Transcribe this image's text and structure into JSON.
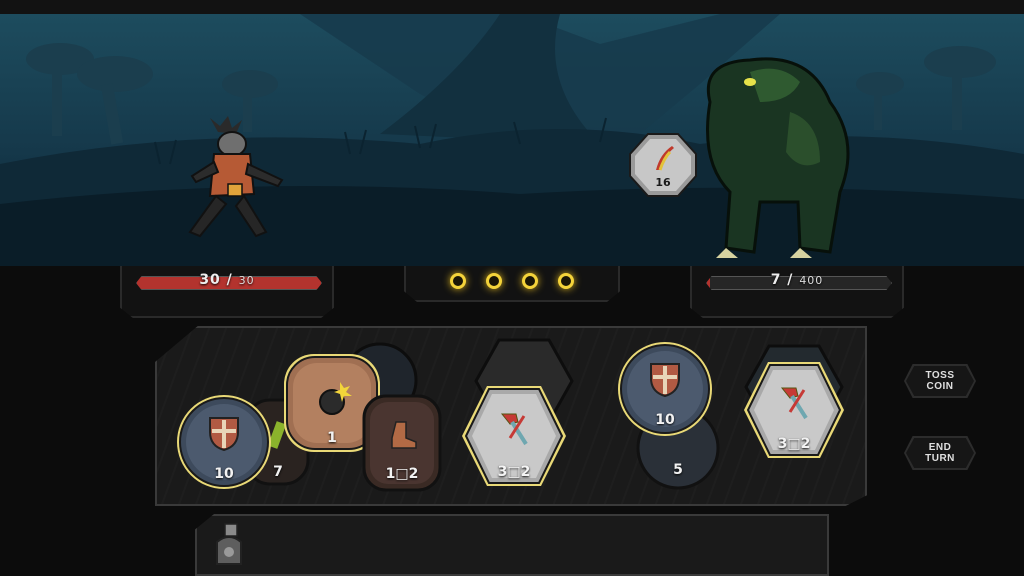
{
  "player": {
    "hp": "30",
    "hp_max": "30",
    "hp_fraction": 1.0
  },
  "enemy": {
    "hp": "7",
    "hp_max": "400",
    "hp_fraction": 0.0175,
    "intent_value": "16",
    "intent_icon": "slash-attack-icon"
  },
  "coins": {
    "count": 4,
    "color": "#f4d33a"
  },
  "hand": {
    "tokens": [
      {
        "name": "shield-10",
        "icon": "shield-icon",
        "value": "10"
      },
      {
        "name": "green-7",
        "icon": "leaf-icon",
        "value": "7"
      },
      {
        "name": "bomb-1",
        "icon": "bomb-icon",
        "value": "1"
      },
      {
        "name": "boot-1x2",
        "icon": "boot-icon",
        "value": "1□2"
      },
      {
        "name": "hammer-3x2-a",
        "icon": "hammer-sword-icon",
        "value": "3□2"
      },
      {
        "name": "shield-10-b",
        "icon": "shield-icon",
        "value": "10"
      },
      {
        "name": "dark-5",
        "icon": "sword-icon",
        "value": "5"
      },
      {
        "name": "hammer-3x2-b",
        "icon": "hammer-sword-icon",
        "value": "3□2"
      }
    ]
  },
  "buttons": {
    "toss": "TOSS\nCOIN",
    "end": "END\nTURN"
  }
}
